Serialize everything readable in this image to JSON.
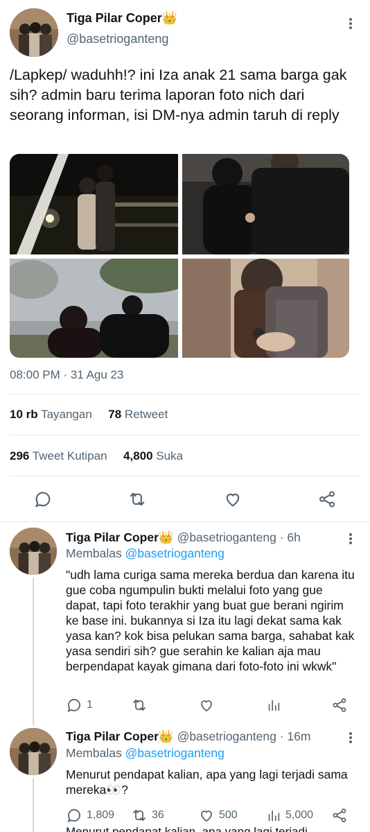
{
  "main": {
    "author_name": "Tiga Pilar Coper",
    "author_badge": "👑",
    "author_handle": "@basetrioganteng",
    "text": "/Lapkep/ waduhh!? ini Iza anak 21 sama barga gak sih? admin baru terima laporan foto nich dari seorang informan, isi DM-nya admin taruh di reply",
    "timestamp": "08:00 PM · 31 Agu 23",
    "stats": {
      "views_count": "10 rb",
      "views_label": "Tayangan",
      "retweets_count": "78",
      "retweets_label": "Retweet",
      "quotes_count": "296",
      "quotes_label": "Tweet Kutipan",
      "likes_count": "4,800",
      "likes_label": "Suka"
    },
    "actions": [
      "reply-icon",
      "retweet-icon",
      "like-icon",
      "share-icon"
    ]
  },
  "replies": [
    {
      "author_name": "Tiga Pilar Coper",
      "author_badge": "👑",
      "author_handle": "@basetrioganteng",
      "time": "· 6h",
      "replying_prefix": "Membalas",
      "replying_to": "@basetrioganteng",
      "text": "\"udh lama curiga sama mereka berdua dan karena itu gue coba ngumpulin bukti melalui foto yang gue dapat, tapi foto terakhir yang buat gue berani ngirim ke base ini. bukannya si Iza itu lagi dekat sama kak yasa kan? kok bisa pelukan sama barga, sahabat kak yasa sendiri sih? gue serahin ke kalian aja mau berpendapat kayak gimana dari foto-foto ini wkwk\"",
      "reply_count": "1",
      "retweet_count": "",
      "like_count": "",
      "view_count": ""
    },
    {
      "author_name": "Tiga Pilar Coper",
      "author_badge": "👑",
      "author_handle": "@basetrioganteng",
      "time": "· 16m",
      "replying_prefix": "Membalas",
      "replying_to": "@basetrioganteng",
      "text": "Menurut pendapat kalian, apa yang lagi terjadi sama mereka👀?",
      "reply_count": "1,809",
      "retweet_count": "36",
      "like_count": "500",
      "view_count": "5,000"
    }
  ],
  "cutoff_text": "Menurut pendapat kalian, apa yang lagi terjadi",
  "colors": {
    "text": "#0f1419",
    "secondary": "#536471",
    "link": "#1d9bf0",
    "divider": "#e1e8ed"
  }
}
